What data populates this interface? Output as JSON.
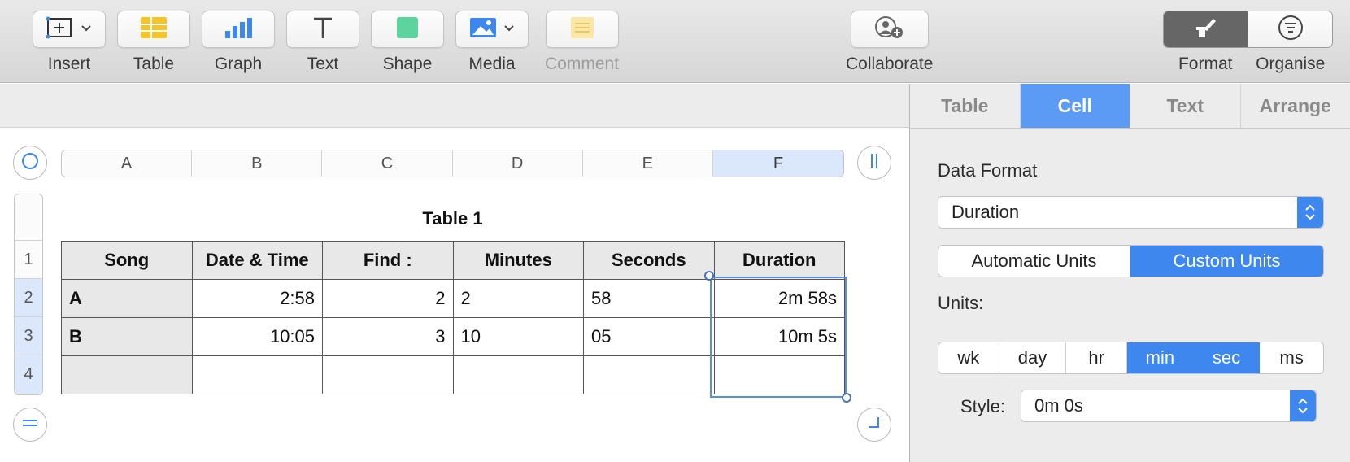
{
  "toolbar": {
    "insert": "Insert",
    "table": "Table",
    "graph": "Graph",
    "text": "Text",
    "shape": "Shape",
    "media": "Media",
    "comment": "Comment",
    "collaborate": "Collaborate",
    "format": "Format",
    "organise": "Organise"
  },
  "sheet": {
    "columns": [
      "A",
      "B",
      "C",
      "D",
      "E",
      "F"
    ],
    "selected_column": "F",
    "rows": [
      "1",
      "2",
      "3",
      "4"
    ],
    "title": "Table 1",
    "headers": [
      "Song",
      "Date & Time",
      "Find :",
      "Minutes",
      "Seconds",
      "Duration"
    ],
    "data": [
      [
        "A",
        "2:58",
        "2",
        "2",
        "58",
        "2m 58s"
      ],
      [
        "B",
        "10:05",
        "3",
        "10",
        "05",
        "10m 5s"
      ],
      [
        "",
        "",
        "",
        "",
        "",
        ""
      ]
    ]
  },
  "inspector": {
    "tabs": [
      "Table",
      "Cell",
      "Text",
      "Arrange"
    ],
    "active_tab": "Cell",
    "data_format_label": "Data Format",
    "data_format_value": "Duration",
    "unit_modes": [
      "Automatic Units",
      "Custom Units"
    ],
    "active_unit_mode": "Custom Units",
    "units_label": "Units:",
    "units": [
      "wk",
      "day",
      "hr",
      "min",
      "sec",
      "ms"
    ],
    "active_units": [
      "min",
      "sec"
    ],
    "style_label": "Style:",
    "style_value": "0m 0s"
  },
  "colors": {
    "accent": "#3e87ef",
    "active_tab": "#5c9bf5",
    "selection": "#5b8fd8"
  }
}
